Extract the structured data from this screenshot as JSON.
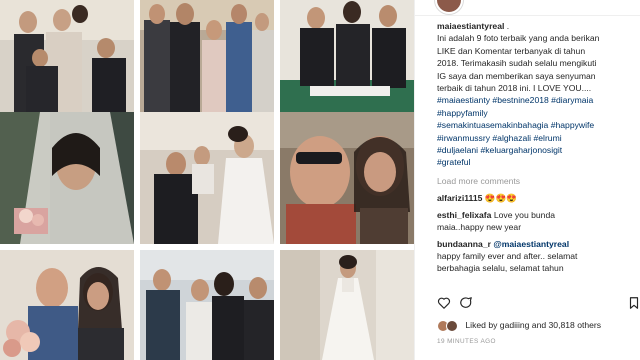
{
  "post": {
    "username": "maiaestiantyreal",
    "caption_lines": [
      "Ini adalah 9 foto terbaik yang anda berikan",
      "LIKE dan Komentar terbanyak di tahun",
      "2018. Terimakasih sudah selalu mengikuti",
      "IG saya dan memberikan saya senyuman",
      "terbaik di tahun 2018 ini. I LOVE YOU...."
    ],
    "hashtag_lines": [
      "#maiaestianty #bestnine2018 #diarymaia",
      "#happyfamily",
      "#semakintuasemakinbahagia #happywife",
      "#irwanmussry #alghazali #elrumi",
      "#duljaelani #keluargaharjonosigit",
      "#grateful"
    ],
    "load_more": "Load more comments",
    "comments": [
      {
        "user": "alfarizi1115",
        "text": "😍😍😍"
      },
      {
        "user": "esthi_felixafa",
        "text": "Love you bunda",
        "text2": "maia..happy new year"
      },
      {
        "user": "bundaanna_r",
        "mention": "@maiaestiantyreal",
        "text2": "happy family ever and after.. selamat",
        "text3": "berbahagia selalu, selamat tahun"
      }
    ],
    "likes_text": "Liked by gadiiing and 30,818 others",
    "time": "19 MINUTES AGO"
  },
  "icons": {
    "heart": "heart-icon",
    "comment": "comment-icon",
    "save": "bookmark-icon"
  }
}
